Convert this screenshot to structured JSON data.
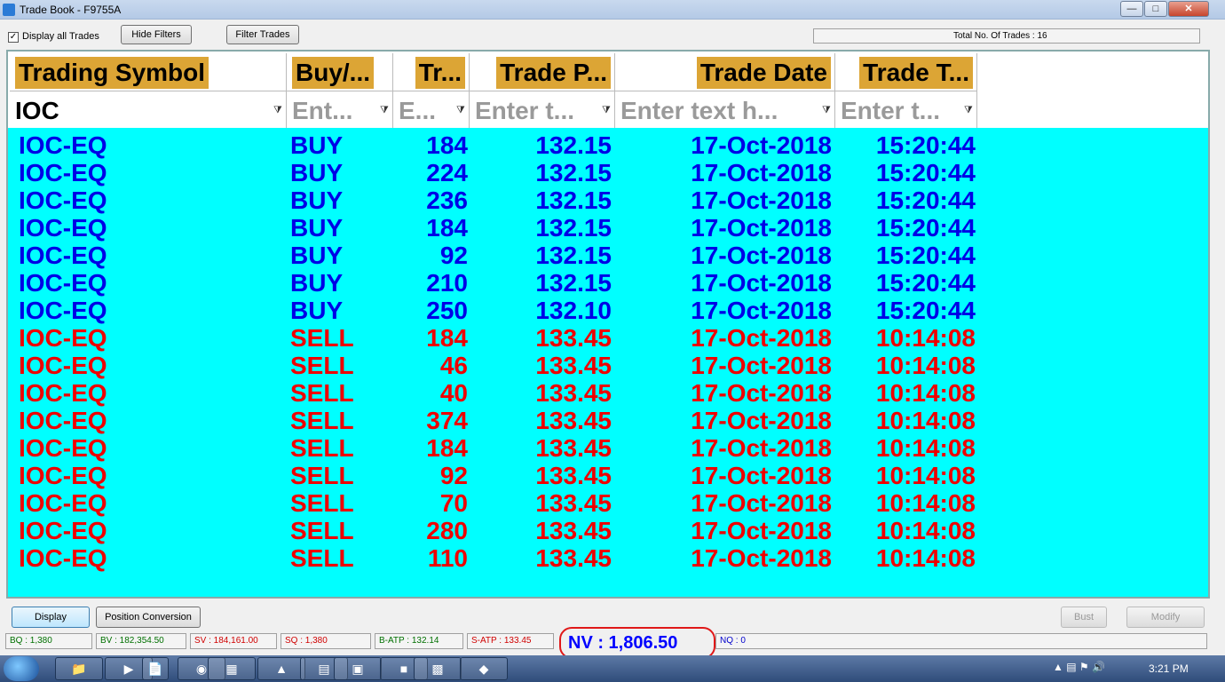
{
  "window": {
    "title": "Trade Book - F9755A"
  },
  "toolbar": {
    "display_all_label": "Display all Trades",
    "display_all_checked": true,
    "hide_filters": "Hide Filters",
    "filter_trades": "Filter Trades",
    "total_trades": "Total No. Of Trades : 16"
  },
  "grid": {
    "headers": [
      "Trading Symbol",
      "Buy/...",
      "Tr...",
      "Trade P...",
      "Trade Date",
      "Trade T..."
    ],
    "filters": [
      {
        "value": "IOC",
        "placeholder": ""
      },
      {
        "value": "",
        "placeholder": "Ent..."
      },
      {
        "value": "",
        "placeholder": "E..."
      },
      {
        "value": "",
        "placeholder": "Enter t..."
      },
      {
        "value": "",
        "placeholder": "Enter text h..."
      },
      {
        "value": "",
        "placeholder": "Enter t..."
      }
    ],
    "colors": {
      "buy": "#0000e6",
      "sell": "#ee0000",
      "background": "#00ffff"
    },
    "rows": [
      {
        "symbol": "IOC-EQ",
        "side": "BUY",
        "qty": "184",
        "price": "132.15",
        "date": "17-Oct-2018",
        "time": "15:20:44"
      },
      {
        "symbol": "IOC-EQ",
        "side": "BUY",
        "qty": "224",
        "price": "132.15",
        "date": "17-Oct-2018",
        "time": "15:20:44"
      },
      {
        "symbol": "IOC-EQ",
        "side": "BUY",
        "qty": "236",
        "price": "132.15",
        "date": "17-Oct-2018",
        "time": "15:20:44"
      },
      {
        "symbol": "IOC-EQ",
        "side": "BUY",
        "qty": "184",
        "price": "132.15",
        "date": "17-Oct-2018",
        "time": "15:20:44"
      },
      {
        "symbol": "IOC-EQ",
        "side": "BUY",
        "qty": "92",
        "price": "132.15",
        "date": "17-Oct-2018",
        "time": "15:20:44"
      },
      {
        "symbol": "IOC-EQ",
        "side": "BUY",
        "qty": "210",
        "price": "132.15",
        "date": "17-Oct-2018",
        "time": "15:20:44"
      },
      {
        "symbol": "IOC-EQ",
        "side": "BUY",
        "qty": "250",
        "price": "132.10",
        "date": "17-Oct-2018",
        "time": "15:20:44"
      },
      {
        "symbol": "IOC-EQ",
        "side": "SELL",
        "qty": "184",
        "price": "133.45",
        "date": "17-Oct-2018",
        "time": "10:14:08"
      },
      {
        "symbol": "IOC-EQ",
        "side": "SELL",
        "qty": "46",
        "price": "133.45",
        "date": "17-Oct-2018",
        "time": "10:14:08"
      },
      {
        "symbol": "IOC-EQ",
        "side": "SELL",
        "qty": "40",
        "price": "133.45",
        "date": "17-Oct-2018",
        "time": "10:14:08"
      },
      {
        "symbol": "IOC-EQ",
        "side": "SELL",
        "qty": "374",
        "price": "133.45",
        "date": "17-Oct-2018",
        "time": "10:14:08"
      },
      {
        "symbol": "IOC-EQ",
        "side": "SELL",
        "qty": "184",
        "price": "133.45",
        "date": "17-Oct-2018",
        "time": "10:14:08"
      },
      {
        "symbol": "IOC-EQ",
        "side": "SELL",
        "qty": "92",
        "price": "133.45",
        "date": "17-Oct-2018",
        "time": "10:14:08"
      },
      {
        "symbol": "IOC-EQ",
        "side": "SELL",
        "qty": "70",
        "price": "133.45",
        "date": "17-Oct-2018",
        "time": "10:14:08"
      },
      {
        "symbol": "IOC-EQ",
        "side": "SELL",
        "qty": "280",
        "price": "133.45",
        "date": "17-Oct-2018",
        "time": "10:14:08"
      },
      {
        "symbol": "IOC-EQ",
        "side": "SELL",
        "qty": "110",
        "price": "133.45",
        "date": "17-Oct-2018",
        "time": "10:14:08"
      }
    ]
  },
  "bottom": {
    "display": "Display",
    "position_conversion": "Position Conversion",
    "bust": "Bust",
    "modify": "Modify"
  },
  "status": {
    "bq": "BQ : 1,380",
    "bv": "BV : 182,354.50",
    "sv": "SV : 184,161.00",
    "sq": "SQ : 1,380",
    "batp": "B-ATP : 132.14",
    "satp": "S-ATP : 133.45",
    "nv": "NV : 1,806.50",
    "nq": "NQ : 0"
  },
  "taskbar": {
    "clock": "3:21 PM"
  }
}
